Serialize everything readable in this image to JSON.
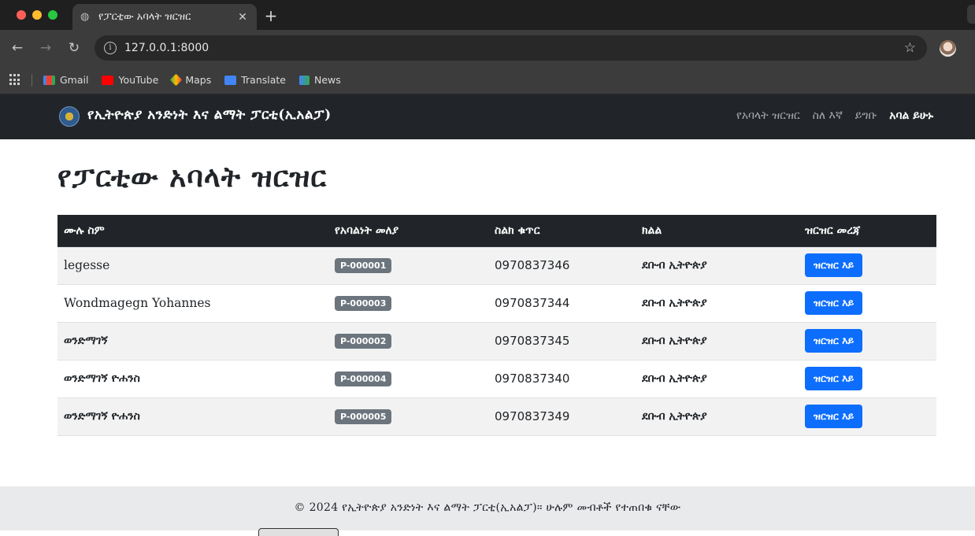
{
  "browser": {
    "tab_title": "የፓርቲው አባላት ዝርዝር",
    "url": "127.0.0.1:8000",
    "bookmarks": [
      {
        "label": "Gmail",
        "icon": "gmail-icon"
      },
      {
        "label": "YouTube",
        "icon": "youtube-icon"
      },
      {
        "label": "Maps",
        "icon": "maps-icon"
      },
      {
        "label": "Translate",
        "icon": "translate-icon"
      },
      {
        "label": "News",
        "icon": "news-icon"
      }
    ]
  },
  "navbar": {
    "brand": "የኢትዮጵያ አንድነት እና ልማት ፓርቲ(ኢአልፓ)",
    "links": [
      {
        "label": "የአባላት ዝርዝር",
        "active": false
      },
      {
        "label": "ስለ እኛ",
        "active": false
      },
      {
        "label": "ይግቡ",
        "active": false
      },
      {
        "label": "አባል ይሁኑ",
        "active": true
      }
    ]
  },
  "page": {
    "title": "የፓርቲው አባላት ዝርዝር"
  },
  "table": {
    "columns": [
      "ሙሉ ስም",
      "የአባልነት መለያ",
      "ስልክ ቁጥር",
      "ክልል",
      "ዝርዝር መረጃ"
    ],
    "rows": [
      {
        "name": "legesse",
        "member_id": "P-000001",
        "phone": "0970837346",
        "region": "ደቡብ ኢትዮጵያ",
        "action": "ዝርዝር እይ"
      },
      {
        "name": "Wondmagegn Yohannes",
        "member_id": "P-000003",
        "phone": "0970837344",
        "region": "ደቡብ ኢትዮጵያ",
        "action": "ዝርዝር እይ"
      },
      {
        "name": "ወንድማገኝ",
        "member_id": "P-000002",
        "phone": "0970837345",
        "region": "ደቡብ ኢትዮጵያ",
        "action": "ዝርዝር እይ"
      },
      {
        "name": "ወንድማገኝ ዮሐንስ",
        "member_id": "P-000004",
        "phone": "0970837340",
        "region": "ደቡብ ኢትዮጵያ",
        "action": "ዝርዝር እይ"
      },
      {
        "name": "ወንድማገኝ ዮሐንስ",
        "member_id": "P-000005",
        "phone": "0970837349",
        "region": "ደቡብ ኢትዮጵያ",
        "action": "ዝርዝር እይ"
      }
    ]
  },
  "footer": {
    "text": "© 2024 የኢትዮጵያ አንድነት እና ልማት ፓርቲ(ኢአልፓ)። ሁሉም መብቶች የተጠበቁ ናቸው"
  },
  "colors": {
    "navbar_bg": "#212529",
    "primary_button": "#0d6efd",
    "badge": "#6c757d",
    "footer_bg": "#e9eaec"
  }
}
